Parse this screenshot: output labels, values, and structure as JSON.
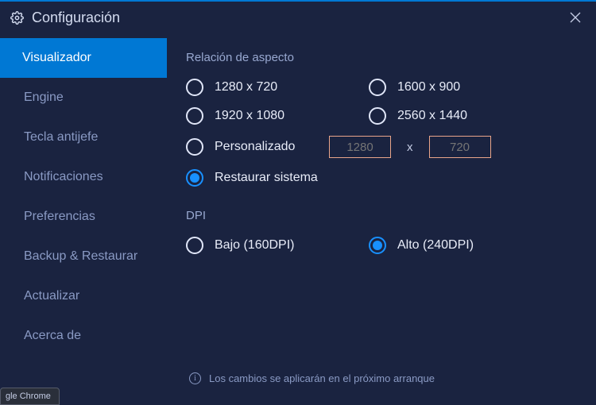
{
  "window": {
    "title": "Configuración"
  },
  "sidebar": {
    "items": [
      {
        "label": "Visualizador",
        "active": true
      },
      {
        "label": "Engine",
        "active": false
      },
      {
        "label": "Tecla antijefe",
        "active": false
      },
      {
        "label": "Notificaciones",
        "active": false
      },
      {
        "label": "Preferencias",
        "active": false
      },
      {
        "label": "Backup & Restaurar",
        "active": false
      },
      {
        "label": "Actualizar",
        "active": false
      },
      {
        "label": "Acerca de",
        "active": false
      }
    ]
  },
  "aspect": {
    "title": "Relación de aspecto",
    "opt0": "1280 x 720",
    "opt1": "1600 x 900",
    "opt2": "1920 x 1080",
    "opt3": "2560 x 1440",
    "custom_label": "Personalizado",
    "custom_w": "1280",
    "custom_h": "720",
    "separator": "x",
    "restore_label": "Restaurar sistema",
    "selected": "restore"
  },
  "dpi": {
    "title": "DPI",
    "low_label": "Bajo (160DPI)",
    "high_label": "Alto (240DPI)",
    "selected": "high"
  },
  "info": {
    "text": "Los cambios se aplicarán en el próximo arranque"
  },
  "taskbar": {
    "label": "gle Chrome"
  }
}
